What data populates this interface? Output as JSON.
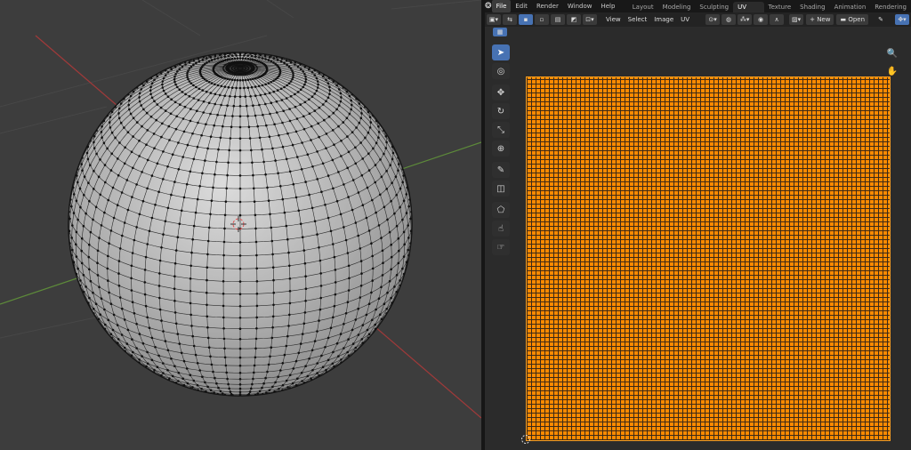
{
  "topbar": {
    "menus": [
      "File",
      "Edit",
      "Render",
      "Window",
      "Help"
    ],
    "active_menu": "File",
    "workspaces": [
      "Layout",
      "Modeling",
      "Sculpting",
      "UV Editing",
      "Texture Paint",
      "Shading",
      "Animation",
      "Rendering"
    ],
    "active_workspace": "UV Editing"
  },
  "uv_header": {
    "menus": [
      "View",
      "Select",
      "Image",
      "UV"
    ],
    "new_label": "New",
    "open_label": "Open"
  },
  "tools": [
    {
      "name": "select-box-tool",
      "icon": "cursor-arrow-icon",
      "glyph": "➤",
      "active": true
    },
    {
      "name": "cursor-tool",
      "icon": "cursor-target-icon",
      "glyph": "◎",
      "active": false
    },
    {
      "name": "move-tool",
      "icon": "move-arrows-icon",
      "glyph": "✥",
      "active": false
    },
    {
      "name": "rotate-tool",
      "icon": "rotate-icon",
      "glyph": "↻",
      "active": false
    },
    {
      "name": "scale-tool",
      "icon": "scale-icon",
      "glyph": "⤡",
      "active": false
    },
    {
      "name": "transform-tool",
      "icon": "transform-icon",
      "glyph": "⊕",
      "active": false
    },
    {
      "name": "annotate-tool",
      "icon": "annotate-pen-icon",
      "glyph": "✎",
      "active": false
    },
    {
      "name": "rip-region-tool",
      "icon": "rip-region-icon",
      "glyph": "◫",
      "active": false
    },
    {
      "name": "grab-tool",
      "icon": "grab-icon",
      "glyph": "⬠",
      "active": false
    },
    {
      "name": "relax-tool",
      "icon": "relax-icon",
      "glyph": "☝",
      "active": false
    },
    {
      "name": "pinch-tool",
      "icon": "pinch-icon",
      "glyph": "☞",
      "active": false
    }
  ],
  "nav_icons": [
    {
      "name": "zoom-icon",
      "glyph": "🔍"
    },
    {
      "name": "pan-hand-icon",
      "glyph": "✋"
    }
  ],
  "colors": {
    "uv_faces": "#ff8a00",
    "active_tool": "#4772b3",
    "viewport_bg": "#3d3d3d",
    "x_axis": "#a03a3a",
    "y_axis": "#5d8a3a"
  }
}
